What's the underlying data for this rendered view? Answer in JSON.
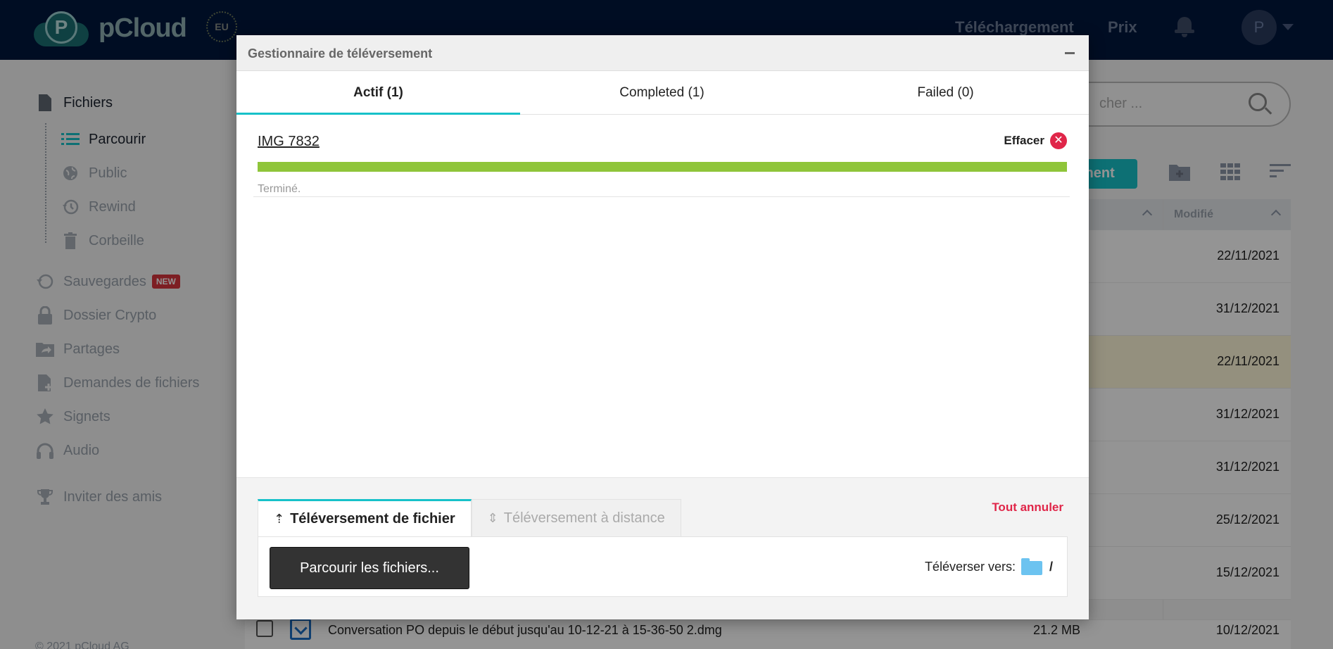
{
  "topbar": {
    "brand": "pCloud",
    "region_badge": "EU",
    "nav_download": "Téléchargement",
    "nav_pricing": "Prix",
    "avatar_initial": "P"
  },
  "sidebar": {
    "files": "Fichiers",
    "browse": "Parcourir",
    "public": "Public",
    "rewind": "Rewind",
    "trash": "Corbeille",
    "backups": "Sauvegardes",
    "backups_badge": "NEW",
    "crypto": "Dossier Crypto",
    "shares": "Partages",
    "file_requests": "Demandes de fichiers",
    "bookmarks": "Signets",
    "audio": "Audio",
    "invite": "Inviter des amis",
    "footer": "© 2021 pCloud AG"
  },
  "main": {
    "search_placeholder": "cher ...",
    "upload_button_partial": "ment",
    "column_modified": "Modifié",
    "dates": [
      "22/11/2021",
      "31/12/2021",
      "22/11/2021",
      "31/12/2021",
      "31/12/2021",
      "25/12/2021",
      "15/12/2021"
    ],
    "last_row": {
      "name": "Conversation PO depuis le début jusqu'au 10-12-21 à 15-36-50 2.dmg",
      "size": "21.2 MB",
      "date": "10/12/2021"
    }
  },
  "modal": {
    "title": "Gestionnaire de téléversement",
    "tabs": {
      "active": "Actif (1)",
      "completed": "Completed (1)",
      "failed": "Failed (0)"
    },
    "item": {
      "file_name": "IMG 7832",
      "clear_label": "Effacer",
      "status": "Terminé.",
      "progress": 1.0
    },
    "cancel_all": "Tout annuler",
    "bottom_tabs": {
      "file_upload": "Téléversement de fichier",
      "remote_upload": "Téléversement à distance"
    },
    "browse_button": "Parcourir les fichiers...",
    "destination_label": "Téléverser vers:",
    "destination_path": "/"
  },
  "colors": {
    "accent": "#17c1c9",
    "progress": "#8fc53a",
    "danger": "#e02649",
    "topbar": "#00173d"
  }
}
